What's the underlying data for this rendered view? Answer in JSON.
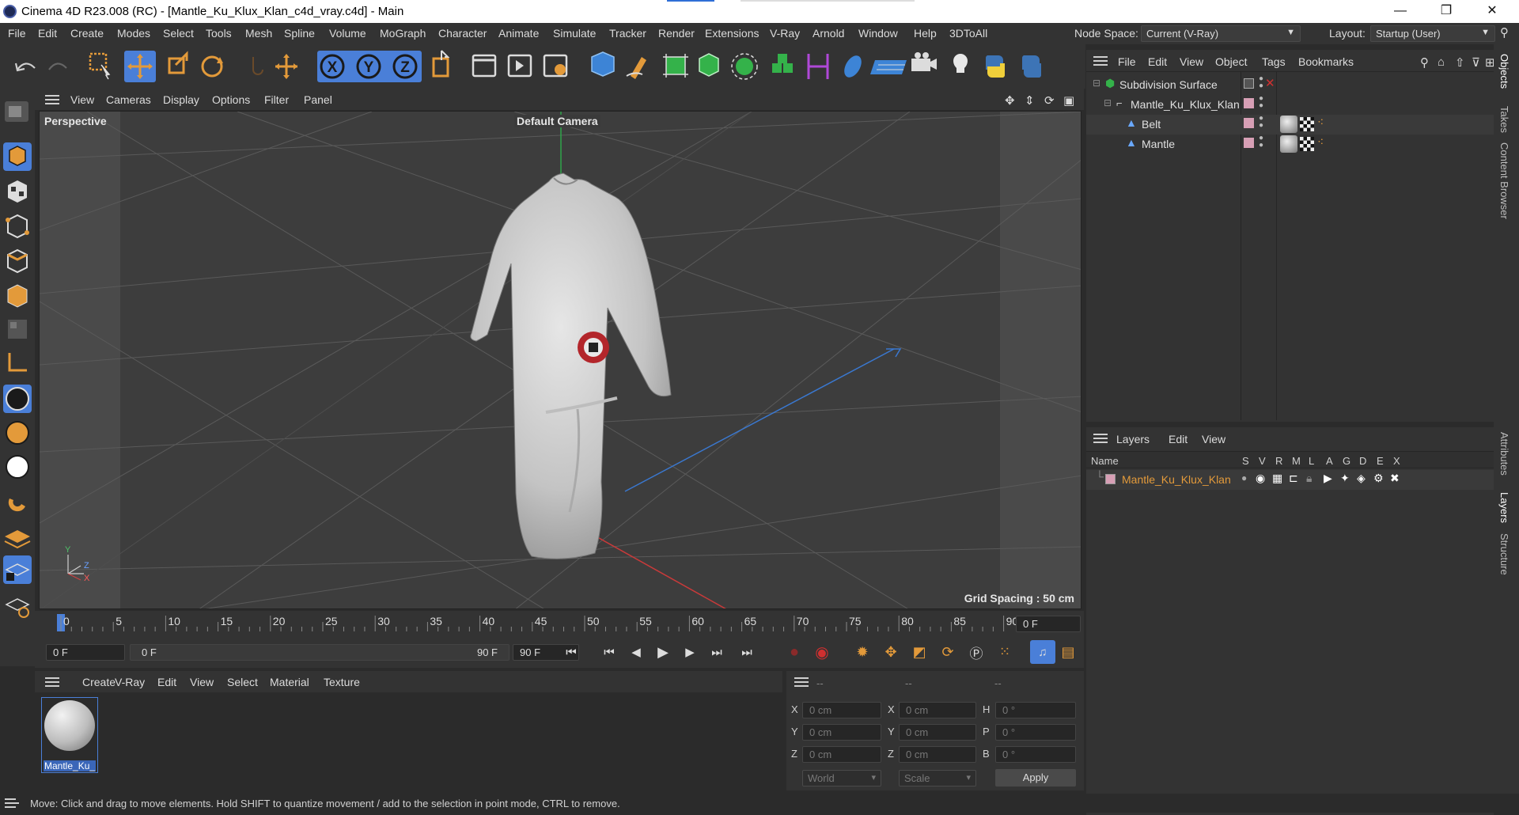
{
  "window": {
    "title": "Cinema 4D R23.008 (RC) - [Mantle_Ku_Klux_Klan_c4d_vray.c4d] - Main",
    "minimize": "—",
    "restore": "❐",
    "close": "✕"
  },
  "menubar": {
    "items": [
      "File",
      "Edit",
      "Create",
      "Modes",
      "Select",
      "Tools",
      "Mesh",
      "Spline",
      "Volume",
      "MoGraph",
      "Character",
      "Animate",
      "Simulate",
      "Tracker",
      "Render",
      "Extensions",
      "V-Ray",
      "Arnold",
      "Window",
      "Help",
      "3DToAll"
    ],
    "node_space_label": "Node Space:",
    "node_space_value": "Current (V-Ray)",
    "layout_label": "Layout:",
    "layout_value": "Startup (User)"
  },
  "viewport": {
    "menu": [
      "View",
      "Cameras",
      "Display",
      "Options",
      "Filter",
      "Panel"
    ],
    "view_name": "Perspective",
    "camera_name": "Default Camera",
    "grid_spacing": "Grid Spacing : 50 cm",
    "axis_y": "Y",
    "axis_z": "Z",
    "axis_x": "X"
  },
  "timeline": {
    "ticks": [
      "0",
      "5",
      "10",
      "15",
      "20",
      "25",
      "30",
      "35",
      "40",
      "45",
      "50",
      "55",
      "60",
      "65",
      "70",
      "75",
      "80",
      "85",
      "90"
    ],
    "current_frame": "0 F"
  },
  "transport": {
    "start_field": "0 F",
    "range_start": "0 F",
    "range_end": "90 F",
    "end_field": "90 F"
  },
  "material_menu": [
    "Create",
    "V-Ray",
    "Edit",
    "View",
    "Select",
    "Material",
    "Texture"
  ],
  "materials": [
    {
      "name": "Mantle_Ku_"
    }
  ],
  "coords": {
    "headers": [
      "--",
      "--",
      "--"
    ],
    "rows": [
      {
        "a": "X",
        "av": "0 cm",
        "b": "X",
        "bv": "0 cm",
        "c": "H",
        "cv": "0 °"
      },
      {
        "a": "Y",
        "av": "0 cm",
        "b": "Y",
        "bv": "0 cm",
        "c": "P",
        "cv": "0 °"
      },
      {
        "a": "Z",
        "av": "0 cm",
        "b": "Z",
        "bv": "0 cm",
        "c": "B",
        "cv": "0 °"
      }
    ],
    "world": "World",
    "scale": "Scale",
    "apply": "Apply"
  },
  "objects": {
    "menu": [
      "File",
      "Edit",
      "View",
      "Object",
      "Tags",
      "Bookmarks"
    ],
    "items": [
      {
        "name": "Subdivision Surface"
      },
      {
        "name": "Mantle_Ku_Klux_Klan"
      },
      {
        "name": "Belt"
      },
      {
        "name": "Mantle"
      }
    ]
  },
  "layers": {
    "menu": [
      "Layers",
      "Edit",
      "View"
    ],
    "columns": [
      "Name",
      "S",
      "V",
      "R",
      "M",
      "L",
      "A",
      "G",
      "D",
      "E",
      "X"
    ],
    "items": [
      {
        "name": "Mantle_Ku_Klux_Klan"
      }
    ]
  },
  "side_tabs": [
    "Objects",
    "Takes",
    "Content Browser",
    "Attributes",
    "Layers",
    "Structure"
  ],
  "status": "Move: Click and drag to move elements. Hold SHIFT to quantize movement / add to the selection in point mode, CTRL to remove.",
  "colors": {
    "accent_orange": "#e39a3a",
    "highlight_blue": "#4a7fd8",
    "layer_color": "#d79fb5"
  }
}
